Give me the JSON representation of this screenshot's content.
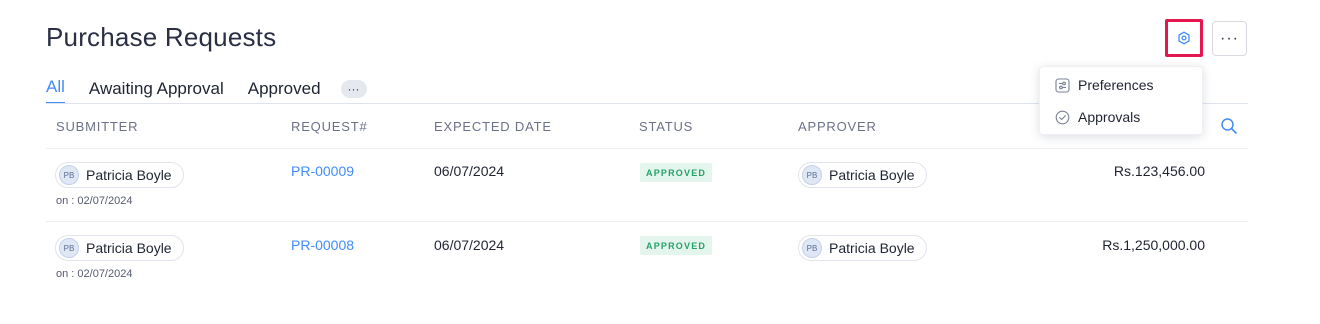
{
  "page": {
    "title": "Purchase Requests"
  },
  "tabs": [
    {
      "label": "All",
      "active": true
    },
    {
      "label": "Awaiting Approval",
      "active": false
    },
    {
      "label": "Approved",
      "active": false
    }
  ],
  "tabs_more_label": "···",
  "header_actions": {
    "settings_icon": "gear-icon",
    "more_label": "···"
  },
  "dropdown": {
    "items": [
      {
        "label": "Preferences",
        "icon": "sliders-icon"
      },
      {
        "label": "Approvals",
        "icon": "check-circle-icon"
      }
    ]
  },
  "table": {
    "columns": [
      "SUBMITTER",
      "REQUEST#",
      "EXPECTED DATE",
      "STATUS",
      "APPROVER"
    ],
    "rows": [
      {
        "submitter": {
          "initials": "PB",
          "name": "Patricia Boyle",
          "date": "on : 02/07/2024"
        },
        "request": "PR-00009",
        "expected_date": "06/07/2024",
        "status": "APPROVED",
        "approver": {
          "initials": "PB",
          "name": "Patricia Boyle"
        },
        "amount": "Rs.123,456.00"
      },
      {
        "submitter": {
          "initials": "PB",
          "name": "Patricia Boyle",
          "date": "on : 02/07/2024"
        },
        "request": "PR-00008",
        "expected_date": "06/07/2024",
        "status": "APPROVED",
        "approver": {
          "initials": "PB",
          "name": "Patricia Boyle"
        },
        "amount": "Rs.1,250,000.00"
      }
    ]
  },
  "colors": {
    "accent": "#408dfb",
    "highlight": "#e4174f",
    "status_approved": "#27a06a"
  }
}
